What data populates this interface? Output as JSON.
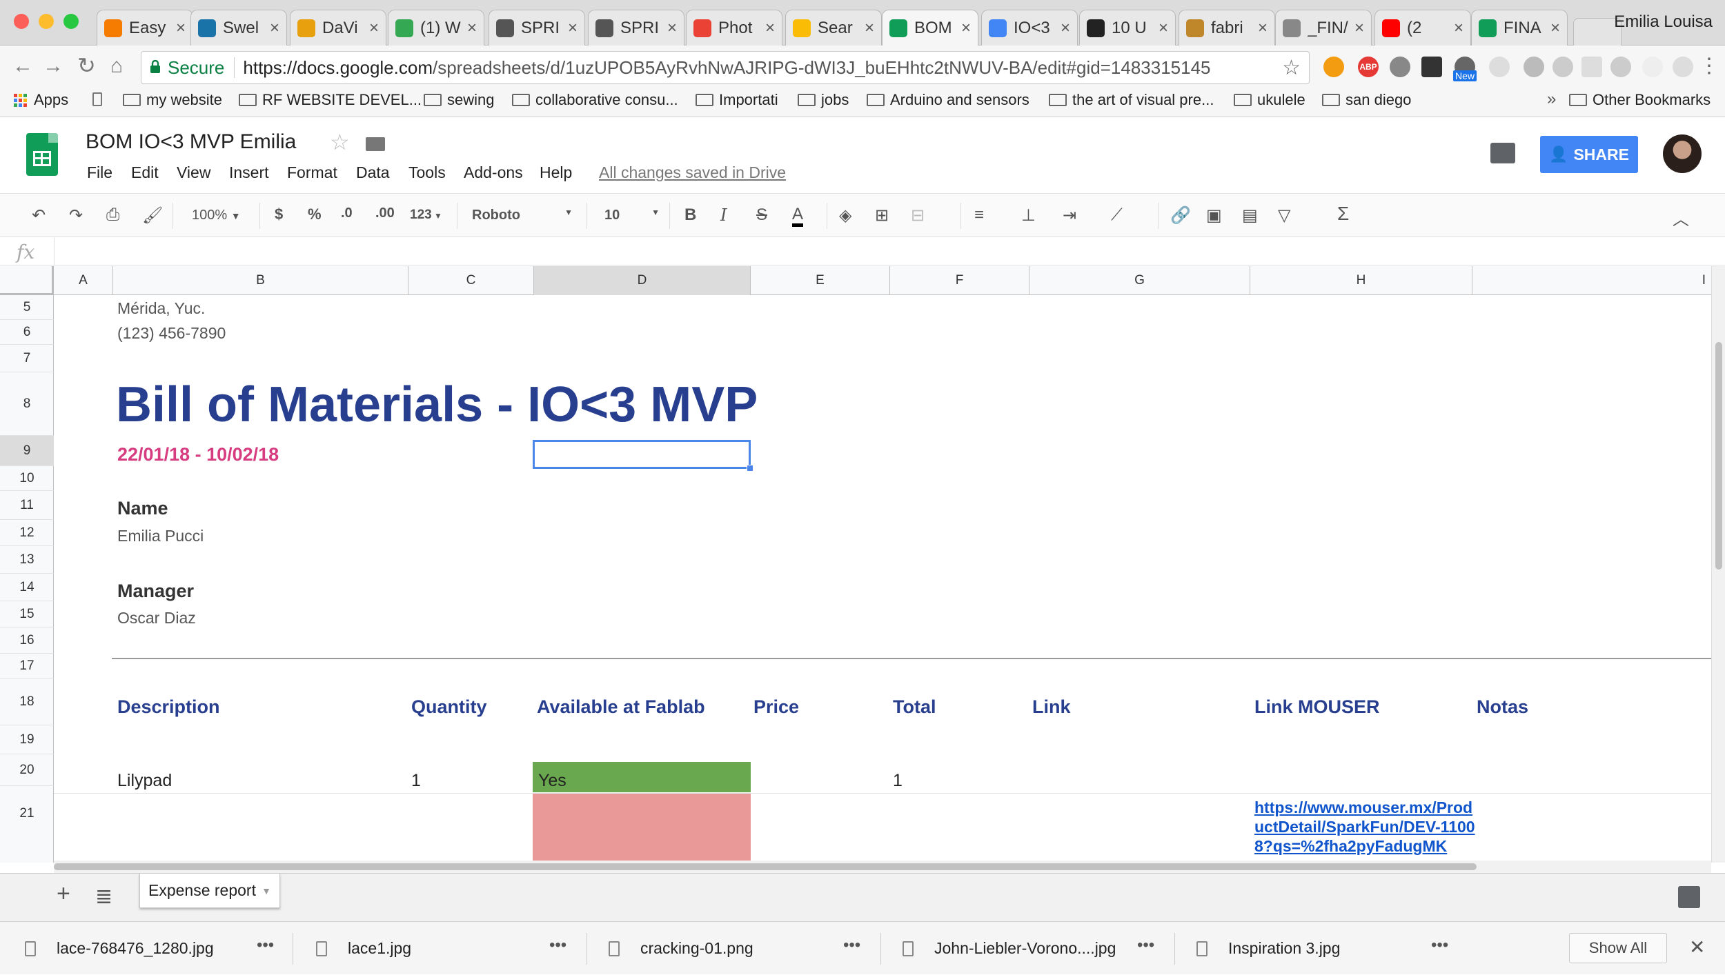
{
  "browser": {
    "tabs": [
      {
        "title": "Easy",
        "favicon_color": "#f57c00"
      },
      {
        "title": "Swel",
        "favicon_color": "#1a73a8"
      },
      {
        "title": "DaVi",
        "favicon_color": "#e8a00f"
      },
      {
        "title": "(1) W",
        "favicon_color": "#34a853"
      },
      {
        "title": "SPRI",
        "favicon_color": "#555555"
      },
      {
        "title": "SPRI",
        "favicon_color": "#555555"
      },
      {
        "title": "Phot",
        "favicon_color": "#ea4335"
      },
      {
        "title": "Sear",
        "favicon_color": "#fbbc05"
      },
      {
        "title": "BOM",
        "favicon_color": "#0f9d58"
      },
      {
        "title": "IO<3",
        "favicon_color": "#4285f4"
      },
      {
        "title": "10 U",
        "favicon_color": "#222222"
      },
      {
        "title": "fabri",
        "favicon_color": "#c0872a"
      },
      {
        "title": "_FIN/",
        "favicon_color": "#888888"
      },
      {
        "title": "(2",
        "favicon_color": "#ff0000"
      },
      {
        "title": "FINA",
        "favicon_color": "#0f9d58"
      }
    ],
    "close_glyph": "×",
    "profile_name": "Emilia Louisa",
    "secure_label": "Secure",
    "url_host": "https://docs.google.com",
    "url_path": "/spreadsheets/d/1uzUPOB5AyRvhNwAJRIPG-dWI3J_buEHhtc2tNWUV-BA/edit#gid=1483315145",
    "new_badge": "New",
    "bookmarks": [
      {
        "label": "Apps"
      },
      {
        "label": "my website"
      },
      {
        "label": "RF WEBSITE DEVEL..."
      },
      {
        "label": "sewing"
      },
      {
        "label": "collaborative consu..."
      },
      {
        "label": "Importati"
      },
      {
        "label": "jobs"
      },
      {
        "label": "Arduino and sensors"
      },
      {
        "label": "the art of visual pre..."
      },
      {
        "label": "ukulele"
      },
      {
        "label": "san diego"
      }
    ],
    "more_bookmarks": "»",
    "other_bookmarks": "Other Bookmarks"
  },
  "app": {
    "doc_title": "BOM IO<3 MVP Emilia",
    "menus": [
      "File",
      "Edit",
      "View",
      "Insert",
      "Format",
      "Data",
      "Tools",
      "Add-ons",
      "Help"
    ],
    "save_status": "All changes saved in Drive",
    "share_label": "SHARE"
  },
  "toolbar": {
    "zoom": "100%",
    "currency": "$",
    "percent": "%",
    "dec_decrease": ".0",
    "dec_increase": ".00",
    "number_format": "123",
    "font": "Roboto",
    "font_size": "10",
    "bold": "B",
    "italic": "I",
    "strike": "S",
    "text_color": "A",
    "sum": "Σ"
  },
  "formula_bar": {
    "fx": "fx",
    "value": ""
  },
  "grid": {
    "columns": [
      "A",
      "B",
      "C",
      "D",
      "E",
      "F",
      "G",
      "H",
      "I"
    ],
    "rows": [
      "5",
      "6",
      "7",
      "8",
      "9",
      "10",
      "11",
      "12",
      "13",
      "14",
      "15",
      "16",
      "17",
      "18",
      "19",
      "20",
      "21"
    ],
    "selected_column": "D",
    "selected_row": "9",
    "cells": {
      "address_city": "Mérida, Yuc.",
      "phone": "(123) 456-7890",
      "title": "Bill of Materials - IO<3 MVP",
      "dates": "22/01/18 - 10/02/18",
      "name_label": "Name",
      "name_value": "Emilia Pucci",
      "manager_label": "Manager",
      "manager_value": "Oscar Diaz"
    },
    "table_headers": [
      "Description",
      "Quantity",
      "Available at Fablab",
      "Price",
      "Total",
      "Link",
      "Link MOUSER",
      "Notas"
    ],
    "rows_data": [
      {
        "description": "Lilypad",
        "quantity": "1",
        "available": "Yes",
        "available_color": "#6aa84f",
        "total": "1"
      },
      {
        "available_color": "#ea9999",
        "link_mouser": "https://www.mouser.mx/ProductDetail/SparkFun/DEV-11008?qs=%2fha2pyFadugMK"
      }
    ]
  },
  "sheets": {
    "active": "Expense report"
  },
  "downloads": {
    "items": [
      "lace-768476_1280.jpg",
      "lace1.jpg",
      "cracking-01.png",
      "John-Liebler-Vorono....jpg",
      "Inspiration 3.jpg"
    ],
    "more_glyph": "•••",
    "show_all": "Show All",
    "close_glyph": "✕"
  }
}
